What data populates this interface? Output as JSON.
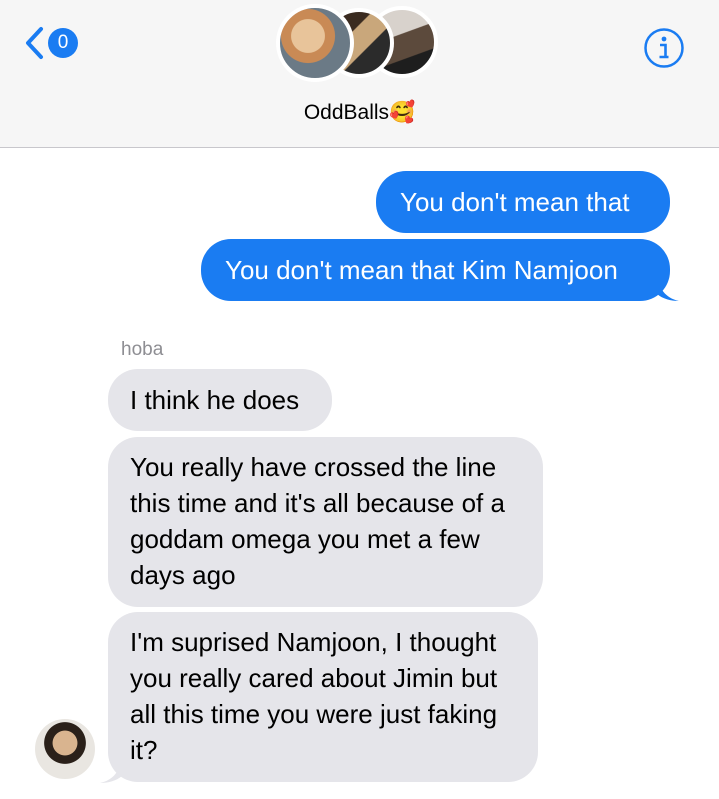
{
  "header": {
    "back_badge": "0",
    "group_name": "OddBalls",
    "group_emoji": "🥰",
    "icons": {
      "back": "chevron-left-icon",
      "info": "info-icon"
    },
    "accent_color": "#1a7cf2"
  },
  "messages": {
    "outgoing": [
      {
        "text": "You don't mean that"
      },
      {
        "text": "You don't mean that Kim Namjoon"
      }
    ],
    "sender_name": "hoba",
    "incoming": [
      {
        "text": "I think he does"
      },
      {
        "text": "You really have crossed the line this time and it's all because of a goddam omega you met a few days ago"
      },
      {
        "text": "I'm suprised Namjoon, I thought you really cared about Jimin but all this time you were just faking it?"
      }
    ]
  }
}
